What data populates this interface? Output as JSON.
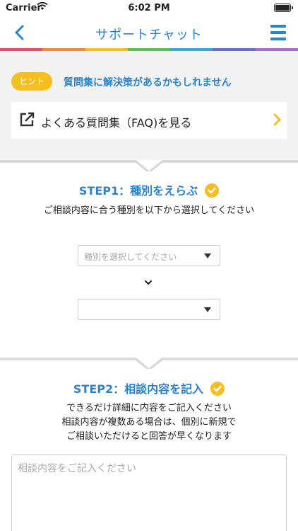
{
  "status_bar": {
    "carrier": "Carrier",
    "time": "6:02 PM"
  },
  "nav": {
    "title": "サポートチャット"
  },
  "colors": {
    "accent": "#2a83d1",
    "hint": "#f5bf1f",
    "rainbow": [
      "#e74c6a",
      "#f08a3c",
      "#f5bf1f",
      "#5cc15a",
      "#3aa6e0",
      "#6b6fd1",
      "#a66fd1"
    ]
  },
  "hint": {
    "badge": "ヒント",
    "text": "質問集に解決策があるかもしれません"
  },
  "faq": {
    "label": "よくある質問集（FAQ)を見る"
  },
  "step1": {
    "title": "STEP1：種別をえらぶ",
    "description": "ご相談内容に合う種別を以下から選択してください",
    "select1_placeholder": "種別を選択してください",
    "select2_placeholder": ""
  },
  "step2": {
    "title": "STEP2：相談内容を記入",
    "description_lines": [
      "できるだけ詳細に内容をご記入ください",
      "相談内容が複数ある場合は、個別に新規で",
      "ご相談いただけると回答が早くなります"
    ],
    "textarea_placeholder": "相談内容をご記入ください"
  }
}
